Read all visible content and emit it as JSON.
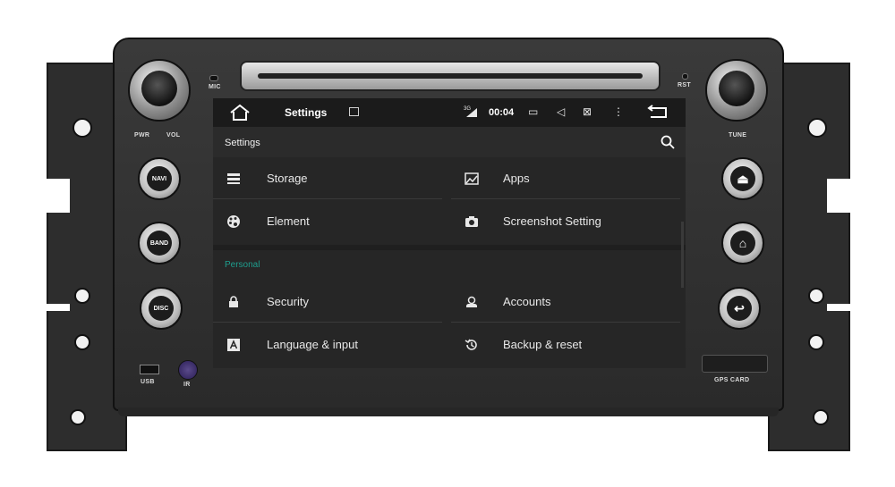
{
  "hardware": {
    "labels": {
      "mic": "MIC",
      "rst": "RST",
      "pwr": "PWR",
      "vol": "VOL",
      "tune": "TUNE",
      "usb": "USB",
      "ir": "IR",
      "gps_card": "GPS CARD"
    },
    "buttons": {
      "navi": "NAVI",
      "band": "BAND",
      "disc": "DISC",
      "eject_icon": "eject-icon",
      "home_icon": "home-icon",
      "back_icon": "back-icon"
    }
  },
  "statusbar": {
    "app_title": "Settings",
    "network": "3G",
    "time": "00:04"
  },
  "toolbar": {
    "title": "Settings"
  },
  "settings": {
    "device_items": [
      {
        "label": "Storage",
        "icon": "storage-icon"
      },
      {
        "label": "Apps",
        "icon": "apps-icon"
      },
      {
        "label": "Element",
        "icon": "palette-icon"
      },
      {
        "label": "Screenshot Setting",
        "icon": "camera-icon"
      }
    ],
    "personal_header": "Personal",
    "personal_items": [
      {
        "label": "Security",
        "icon": "lock-icon"
      },
      {
        "label": "Accounts",
        "icon": "account-icon"
      },
      {
        "label": "Language & input",
        "icon": "language-icon"
      },
      {
        "label": "Backup & reset",
        "icon": "backup-icon"
      }
    ]
  },
  "colors": {
    "accent": "#1e9e8e",
    "screen_bg": "#262626",
    "statusbar_bg": "#1b1b1b"
  }
}
